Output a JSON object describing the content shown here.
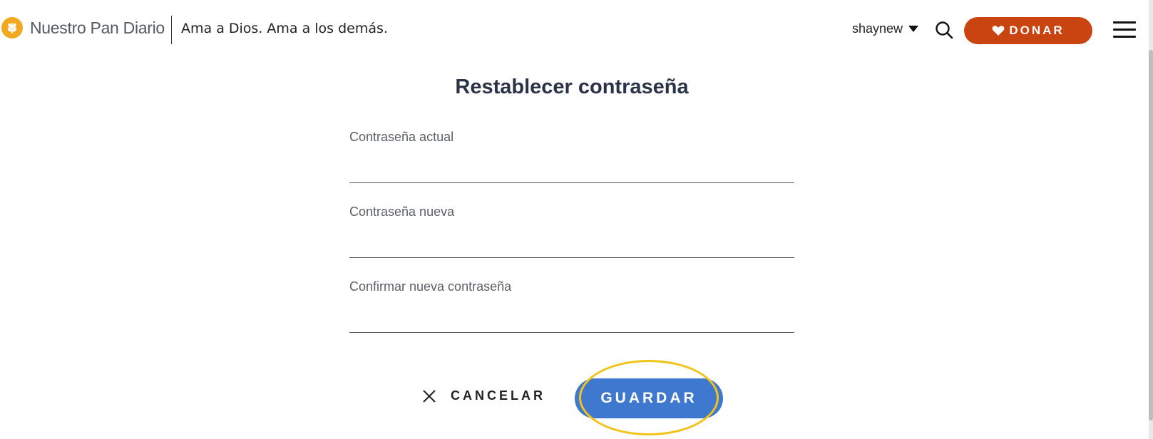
{
  "header": {
    "brand_name": "Nuestro Pan Diario",
    "tagline": "Ama a Dios. Ama a los demás.",
    "username": "shaynew",
    "donate_label": "DONAR",
    "brand_color": "#f2a91f",
    "donate_color": "#c94410"
  },
  "form": {
    "title": "Restablecer contraseña",
    "fields": [
      {
        "label": "Contraseña actual",
        "value": ""
      },
      {
        "label": "Contraseña nueva",
        "value": ""
      },
      {
        "label": "Confirmar nueva contraseña",
        "value": ""
      }
    ],
    "cancel_label": "CANCELAR",
    "save_label": "GUARDAR",
    "save_color": "#3f78cf",
    "highlight_color": "#f2c318"
  },
  "icons": {
    "logo": "wheat-logo-icon",
    "user_menu": "caret-down-icon",
    "search": "search-icon",
    "donate": "heart-icon",
    "menu": "hamburger-menu-icon",
    "cancel": "close-icon"
  }
}
